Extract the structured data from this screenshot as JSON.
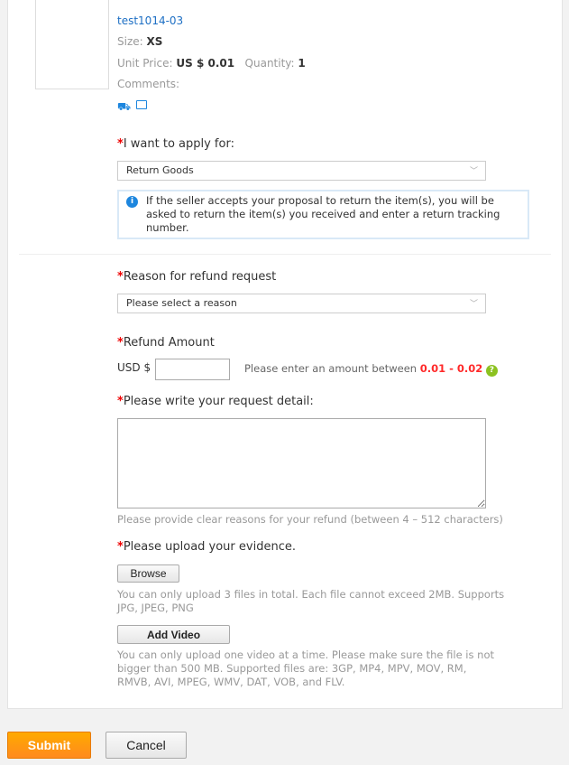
{
  "product": {
    "name": "test1014-03",
    "size_label": "Size:",
    "size": "XS",
    "price_label": "Unit Price:",
    "price": "US $ 0.01",
    "qty_label": "Quantity:",
    "qty": "1",
    "comments_label": "Comments:"
  },
  "apply": {
    "star": "*",
    "label": "I want to apply for:",
    "selected": "Return Goods",
    "info": "If the seller accepts your proposal to return the item(s), you will be asked to return the item(s) you received and enter a return tracking number."
  },
  "reason": {
    "star": "*",
    "label": "Reason for refund request",
    "selected": "Please select a reason"
  },
  "amount": {
    "star": "*",
    "label": "Refund Amount",
    "currency": "USD $",
    "value": "",
    "hint": "Please enter an amount between",
    "range": "0.01 - 0.02"
  },
  "detail": {
    "star": "*",
    "label": "Please write your request detail:",
    "value": "",
    "hint": "Please provide clear reasons for your refund (between 4 – 512 characters)"
  },
  "evidence": {
    "star": "*",
    "label": "Please upload your evidence.",
    "browse": "Browse",
    "browse_hint": "You can only upload 3 files in total. Each file cannot exceed 2MB. Supports JPG, JPEG, PNG",
    "video": "Add Video",
    "video_hint": "You can only upload one video at a time. Please make sure the file is not bigger than 500 MB. Supported files are: 3GP, MP4, MPV, MOV, RM, RMVB, AVI, MPEG, WMV, DAT, VOB, and FLV."
  },
  "actions": {
    "submit": "Submit",
    "cancel": "Cancel"
  },
  "colors": {
    "accent": "#ff9900",
    "link": "#1d6fc4",
    "required": "#e00000",
    "range": "#ff2a2a"
  }
}
